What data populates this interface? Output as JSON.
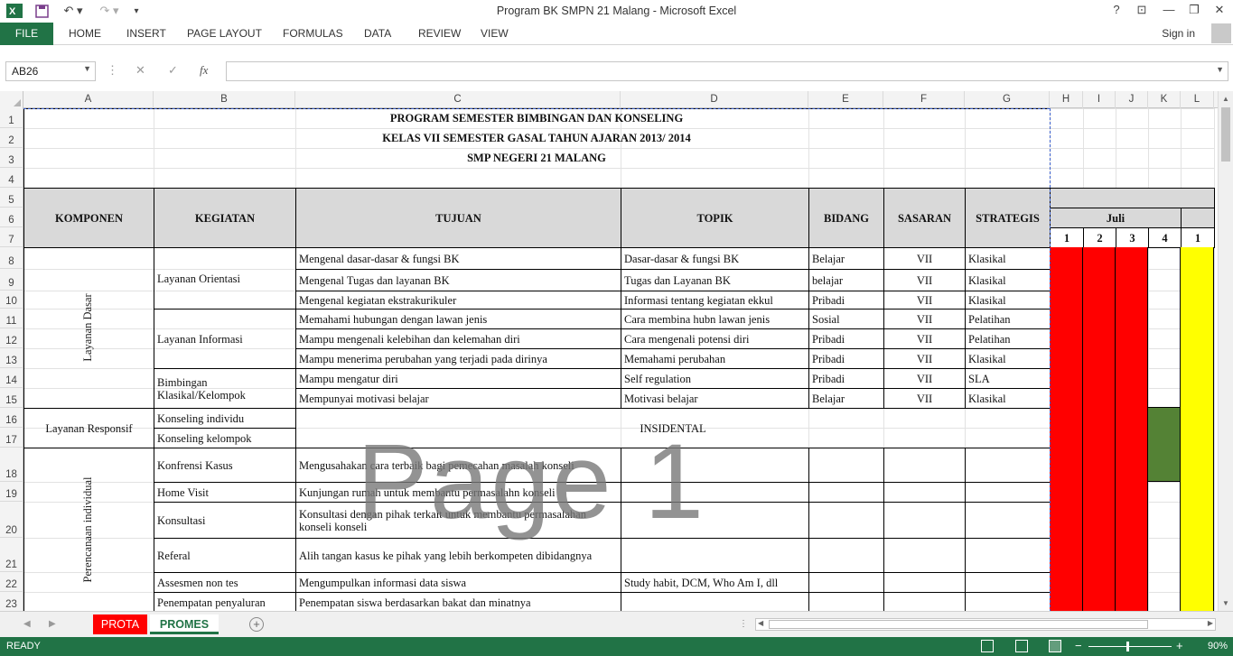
{
  "window": {
    "title": "Program BK SMPN 21 Malang - Microsoft Excel",
    "help": "?",
    "minimize": "—",
    "restore": "❐",
    "close": "✕"
  },
  "ribbon": {
    "file": "FILE",
    "tabs": [
      "HOME",
      "INSERT",
      "PAGE LAYOUT",
      "FORMULAS",
      "DATA",
      "REVIEW",
      "VIEW"
    ],
    "signin": "Sign in"
  },
  "formula_bar": {
    "name_box": "AB26",
    "fx": "fx",
    "value": ""
  },
  "columns": [
    "A",
    "B",
    "C",
    "D",
    "E",
    "F",
    "G",
    "H",
    "I",
    "J",
    "K",
    "L"
  ],
  "rows": [
    "1",
    "2",
    "3",
    "4",
    "5",
    "6",
    "7",
    "8",
    "9",
    "10",
    "11",
    "12",
    "13",
    "14",
    "15",
    "16",
    "17",
    "18",
    "19",
    "20",
    "21",
    "22",
    "23"
  ],
  "sheet": {
    "title1": "PROGRAM SEMESTER BIMBINGAN DAN KONSELING",
    "title2": "KELAS VII SEMESTER GASAL TAHUN AJARAN 2013/ 2014",
    "title3": "SMP NEGERI 21 MALANG",
    "headers": {
      "komponen": "KOMPONEN",
      "kegiatan": "KEGIATAN",
      "tujuan": "TUJUAN",
      "topik": "TOPIK",
      "bidang": "BIDANG",
      "sasaran": "SASARAN",
      "strategis": "STRATEGIS",
      "month": "Juli",
      "weeks": [
        "1",
        "2",
        "3",
        "4",
        "1"
      ]
    },
    "komponen": {
      "dasar": "Layanan Dasar",
      "responsif": "Layanan Responsif",
      "individual": "Perencanaan individual"
    },
    "kegiatan": {
      "orientasi": "Layanan Orientasi",
      "informasi": "Layanan Informasi",
      "klasikal": "Bimbingan Klasikal/Kelompok",
      "konseling_individu": "Konseling individu",
      "konseling_kelompok": "Konseling kelompok",
      "konfrensi": "Konfrensi Kasus",
      "home_visit": "Home Visit",
      "konsultasi": "Konsultasi",
      "referal": "Referal",
      "assesmen": "Assesmen non tes",
      "penempatan": "Penempatan penyaluran"
    },
    "insidental": "INSIDENTAL",
    "detail_rows": [
      {
        "tujuan": "Mengenal  dasar-dasar & fungsi BK",
        "topik": "Dasar-dasar & fungsi BK",
        "bidang": "Belajar",
        "sasaran": "VII",
        "strategis": "Klasikal"
      },
      {
        "tujuan": "Mengenal Tugas dan layanan BK",
        "topik": "Tugas dan Layanan BK",
        "bidang": "belajar",
        "sasaran": "VII",
        "strategis": "Klasikal"
      },
      {
        "tujuan": "Mengenal kegiatan ekstrakurikuler",
        "topik": "Informasi tentang kegiatan ekkul",
        "bidang": "Pribadi",
        "sasaran": "VII",
        "strategis": "Klasikal"
      },
      {
        "tujuan": "Memahami  hubungan dengan  lawan jenis",
        "topik": "Cara membina hubn lawan jenis",
        "bidang": "Sosial",
        "sasaran": "VII",
        "strategis": "Pelatihan"
      },
      {
        "tujuan": "Mampu mengenali kelebihan dan kelemahan diri",
        "topik": "Cara mengenali potensi diri",
        "bidang": "Pribadi",
        "sasaran": "VII",
        "strategis": "Pelatihan"
      },
      {
        "tujuan": "Mampu menerima perubahan yang terjadi pada dirinya",
        "topik": "Memahami perubahan",
        "bidang": "Pribadi",
        "sasaran": "VII",
        "strategis": "Klasikal"
      },
      {
        "tujuan": "Mampu mengatur diri",
        "topik": "Self regulation",
        "bidang": "Pribadi",
        "sasaran": "VII",
        "strategis": "SLA"
      },
      {
        "tujuan": "Mempunyai motivasi belajar",
        "topik": "Motivasi belajar",
        "bidang": "Belajar",
        "sasaran": "VII",
        "strategis": "Klasikal"
      }
    ],
    "lower_rows": [
      {
        "tujuan": "Mengusahakan cara terbaik bagi pemecahan masalah konseli",
        "topik": ""
      },
      {
        "tujuan": "Kunjungan rumah untuk membantu permasalahn konseli",
        "topik": ""
      },
      {
        "tujuan": "Konsultasi dengan pihak terkait untuk membantu permasalahan konseli konseli",
        "topik": ""
      },
      {
        "tujuan": "Alih tangan kasus ke pihak yang lebih berkompeten dibidangnya",
        "topik": ""
      },
      {
        "tujuan": "Mengumpulkan informasi data siswa",
        "topik": "Study habit, DCM, Who Am I, dll"
      },
      {
        "tujuan": "Penempatan siswa berdasarkan bakat dan minatnya",
        "topik": ""
      }
    ],
    "watermark": "Page 1"
  },
  "sheet_tabs": [
    "PROTA",
    "PROMES"
  ],
  "active_sheet": "PROMES",
  "status": {
    "ready": "READY",
    "zoom": "90%"
  },
  "colors": {
    "excel_green": "#217346",
    "header_gray": "#d9d9d9",
    "red": "#ff0000",
    "yellow": "#ffff00",
    "green": "#548235"
  }
}
